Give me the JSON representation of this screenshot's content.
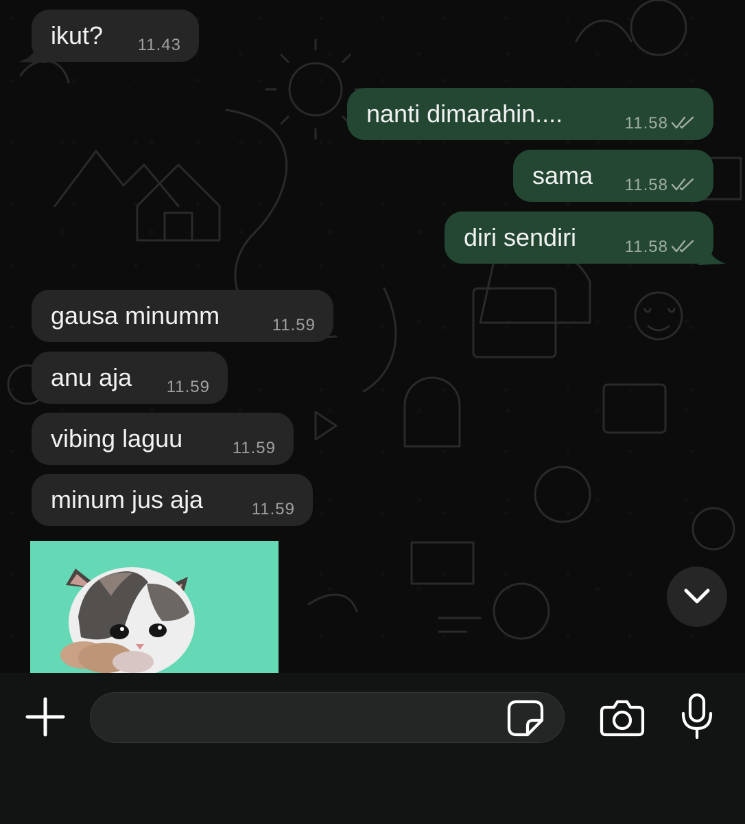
{
  "messages": [
    {
      "direction": "incoming",
      "text": "ikut?",
      "time": "11.43"
    },
    {
      "direction": "outgoing",
      "text": "nanti dimarahin....",
      "time": "11.58",
      "status": "read"
    },
    {
      "direction": "outgoing",
      "text": "sama",
      "time": "11.58",
      "status": "read"
    },
    {
      "direction": "outgoing",
      "text": "diri sendiri",
      "time": "11.58",
      "status": "read"
    },
    {
      "direction": "incoming",
      "text": "gausa minumm",
      "time": "11.59"
    },
    {
      "direction": "incoming",
      "text": "anu aja",
      "time": "11.59"
    },
    {
      "direction": "incoming",
      "text": "vibing laguu",
      "time": "11.59"
    },
    {
      "direction": "incoming",
      "text": "minum jus aja",
      "time": "11.59"
    }
  ],
  "sticker": {
    "subject": "kitten-sticker",
    "background": "#65d9b6"
  },
  "composer": {
    "input_value": "",
    "input_placeholder": "",
    "icons": [
      "plus-icon",
      "sticker-icon",
      "camera-icon",
      "microphone-icon"
    ]
  },
  "scroll_down_icon": "chevron-down-icon",
  "colors": {
    "background": "#0c0c0c",
    "incoming_bubble": "#262626",
    "outgoing_bubble": "#234733",
    "composer_bar": "#121414",
    "sticker_bg": "#65d9b6"
  }
}
